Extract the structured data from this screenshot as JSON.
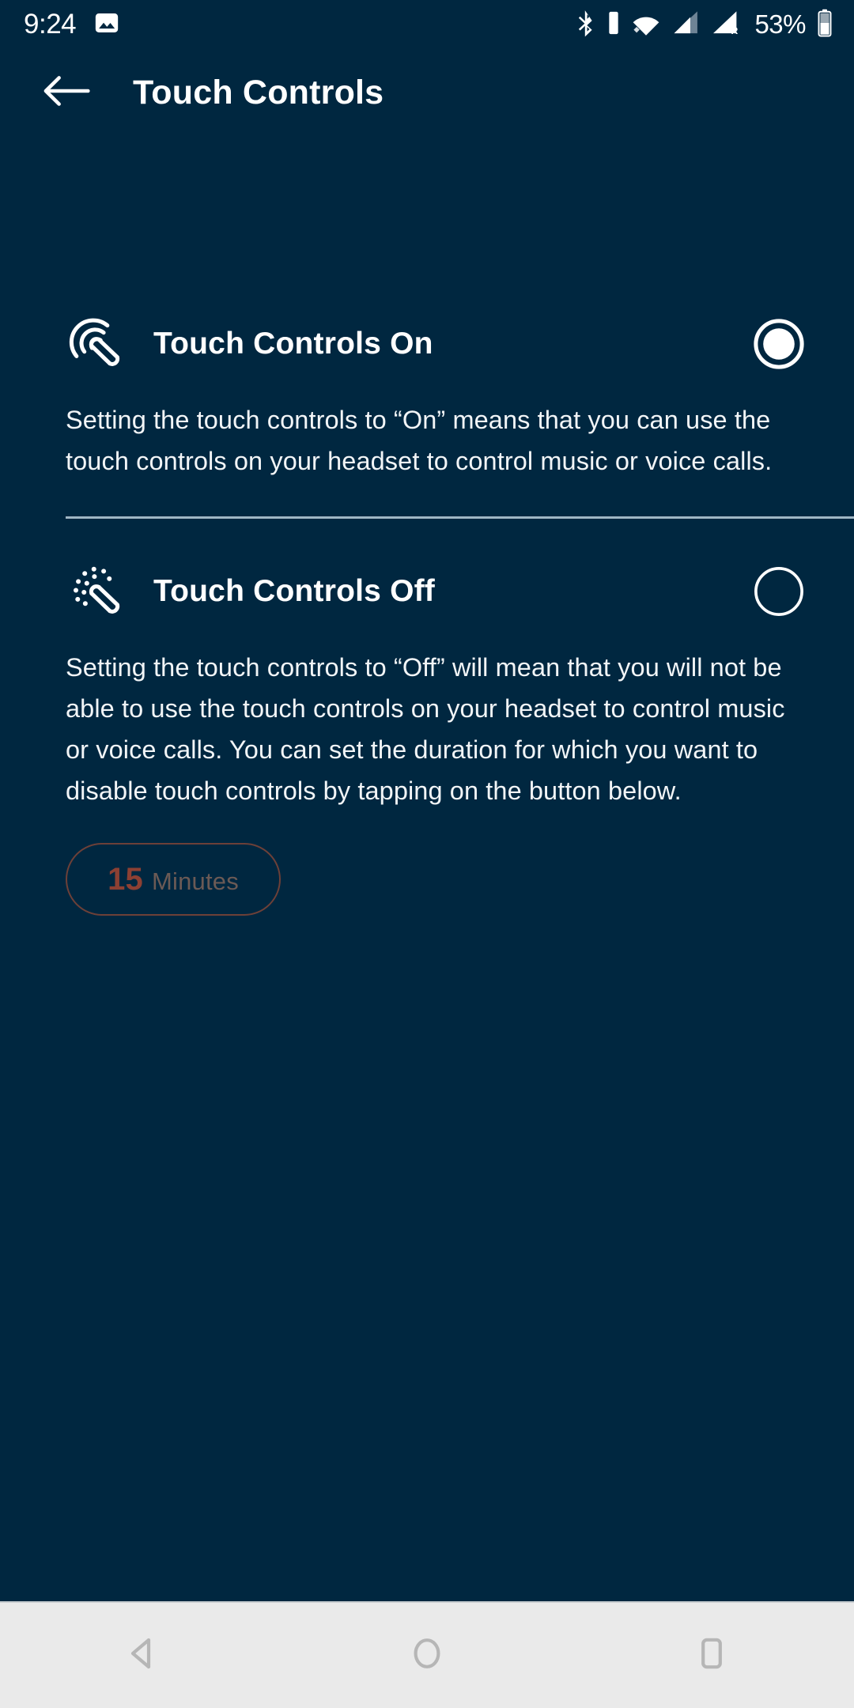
{
  "status_bar": {
    "time": "9:24",
    "battery_percent": "53%",
    "icons": [
      "image-icon",
      "bluetooth-icon",
      "bluetooth-battery-icon",
      "wifi-icon",
      "signal-icon",
      "signal-roaming-icon",
      "battery-icon"
    ],
    "roaming_label": "R"
  },
  "app_bar": {
    "back_label": "back-arrow",
    "title": "Touch Controls"
  },
  "options": [
    {
      "icon": "touch-gesture-on-icon",
      "title": "Touch Controls On",
      "selected": true,
      "description": "Setting the touch controls to “On” means that you can use the touch controls on your headset to control music or voice calls."
    },
    {
      "icon": "touch-gesture-off-icon",
      "title": "Touch Controls Off",
      "selected": false,
      "description": "Setting the touch controls to “Off” will mean that you will not be able to use the touch controls on your headset to control music or voice calls. You can set the duration for which you want to disable touch controls by tapping on the button below."
    }
  ],
  "duration_button": {
    "value": "15",
    "unit": "Minutes"
  },
  "nav_bar": {
    "back": "nav-back-icon",
    "home": "nav-home-icon",
    "recents": "nav-recents-icon"
  },
  "colors": {
    "background": "#002740",
    "text_primary": "#ffffff",
    "divider": "#9fb6c4",
    "accent_disabled": "#8c4033",
    "accent_border": "#6d4038",
    "nav_bar_bg": "#eaeaea"
  }
}
